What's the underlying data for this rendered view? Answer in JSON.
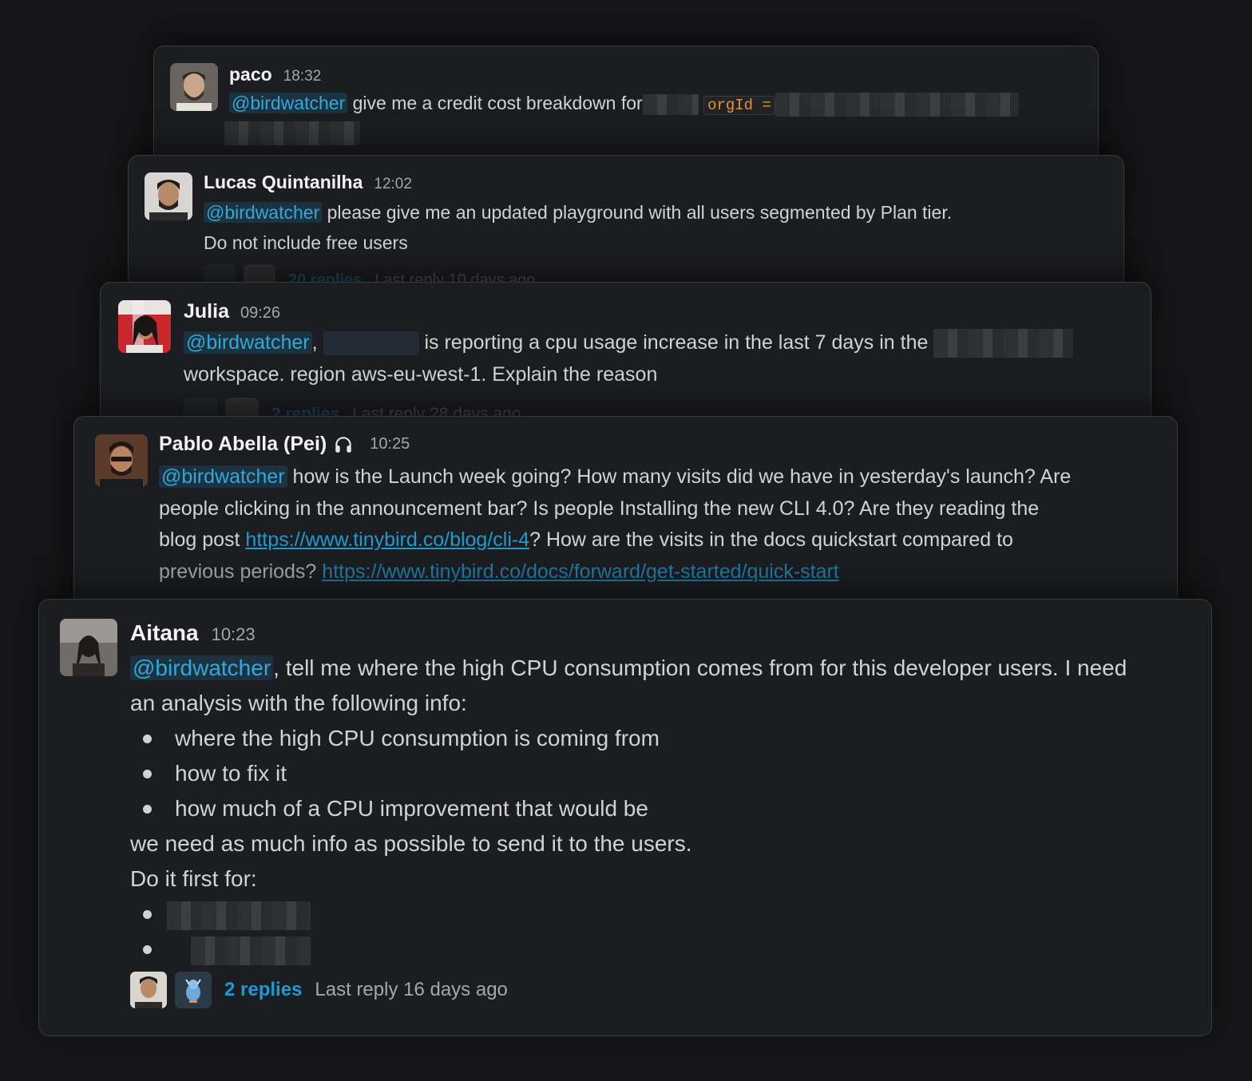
{
  "messages": {
    "paco": {
      "name": "paco",
      "time": "18:32",
      "mention": "@birdwatcher",
      "text": " give me a credit cost breakdown for",
      "code": "orgId ="
    },
    "lucas": {
      "name": "Lucas Quintanilha",
      "time": "12:02",
      "mention": "@birdwatcher",
      "line1": " please give me an updated playground with all users segmented by Plan tier.",
      "line2": "Do not include free users",
      "replies": "20 replies",
      "last_reply": "Last reply 10 days ago"
    },
    "julia": {
      "name": "Julia",
      "time": "09:26",
      "mention": "@birdwatcher",
      "comma": ",",
      "line1": "is reporting a cpu usage increase in the last 7 days in the",
      "line2": "workspace. region aws-eu-west-1. Explain the reason",
      "replies": "2 replies",
      "last_reply": "Last reply 28 days ago"
    },
    "pablo": {
      "name": "Pablo Abella (Pei)",
      "status_icon": "headphones-icon",
      "time": "10:25",
      "mention": "@birdwatcher",
      "line1": " how is the Launch week going? How many visits did we have in yesterday's launch? Are",
      "line2": "people clicking in the announcement bar? Is people Installing the new CLI 4.0? Are they reading the",
      "line3_prefix": "blog post ",
      "link1": "https://www.tinybird.co/blog/cli-4",
      "line3_suffix": "? How are the visits in the docs quickstart compared to",
      "line4_prefix": "previous periods? ",
      "link2": "https://www.tinybird.co/docs/forward/get-started/quick-start"
    },
    "aitana": {
      "name": "Aitana",
      "time": "10:23",
      "mention": "@birdwatcher",
      "line1": ", tell me where the high CPU consumption comes from for this developer users. I need",
      "line2": "an analysis with the following info:",
      "bullets": [
        "where the high CPU consumption is coming from",
        "how to fix it",
        "how much of a CPU improvement that would be"
      ],
      "line3": "we need as much info as possible to send it to the users.",
      "line4": "Do it first for:",
      "replies": "2 replies",
      "last_reply": "Last reply 16 days ago"
    }
  },
  "colors": {
    "background": "#161618",
    "card": "#1c1d21",
    "mention": "#36a6d8",
    "link": "#1d9bd1",
    "code": "#e8912d"
  }
}
